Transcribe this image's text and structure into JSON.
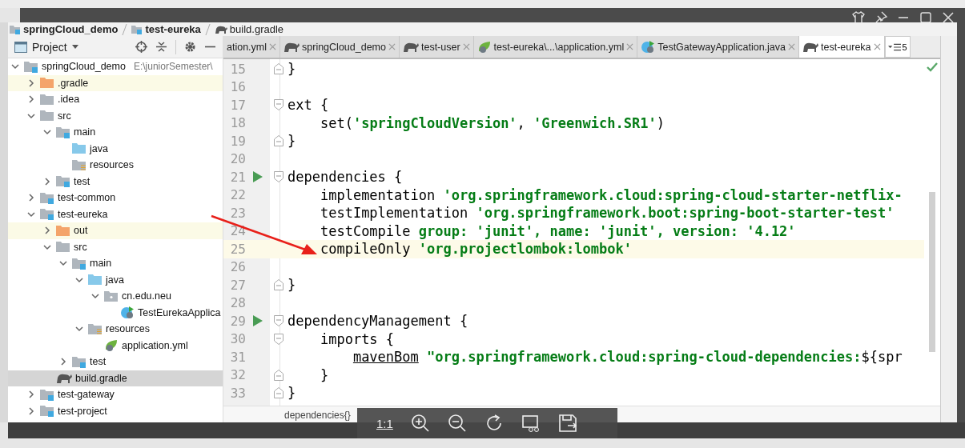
{
  "breadcrumbs": [
    {
      "label": "springCloud_demo",
      "kind": "module"
    },
    {
      "label": "test-eureka",
      "kind": "module"
    },
    {
      "label": "build.gradle",
      "kind": "gradle"
    }
  ],
  "project_panel": {
    "title": "Project"
  },
  "tree": [
    {
      "label": "springCloud_demo",
      "path": "E:\\juniorSemester\\",
      "kind": "module",
      "expanded": true,
      "selected": false,
      "children": [
        {
          "label": ".gradle",
          "kind": "excluded",
          "expanded": false,
          "selected": false
        },
        {
          "label": ".idea",
          "kind": "folder",
          "expanded": false,
          "selected": false
        },
        {
          "label": "src",
          "kind": "folder",
          "expanded": true,
          "selected": false,
          "children": [
            {
              "label": "main",
              "kind": "module",
              "expanded": true,
              "selected": false,
              "children": [
                {
                  "label": "java",
                  "kind": "source",
                  "selected": false
                },
                {
                  "label": "resources",
                  "kind": "resources",
                  "selected": false
                }
              ]
            },
            {
              "label": "test",
              "kind": "module",
              "expanded": false,
              "selected": false
            }
          ]
        },
        {
          "label": "test-common",
          "kind": "module",
          "expanded": false,
          "selected": false
        },
        {
          "label": "test-eureka",
          "kind": "module",
          "expanded": true,
          "selected": false,
          "children": [
            {
              "label": "out",
              "kind": "excluded",
              "expanded": false,
              "selected": false
            },
            {
              "label": "src",
              "kind": "folder",
              "expanded": true,
              "selected": false,
              "children": [
                {
                  "label": "main",
                  "kind": "module",
                  "expanded": true,
                  "selected": false,
                  "children": [
                    {
                      "label": "java",
                      "kind": "source",
                      "expanded": true,
                      "selected": false,
                      "children": [
                        {
                          "label": "cn.edu.neu",
                          "kind": "package",
                          "expanded": true,
                          "selected": false,
                          "children": [
                            {
                              "label": "TestEurekaApplica",
                              "kind": "class",
                              "selected": false
                            }
                          ]
                        }
                      ]
                    },
                    {
                      "label": "resources",
                      "kind": "resources",
                      "expanded": true,
                      "selected": false,
                      "children": [
                        {
                          "label": "application.yml",
                          "kind": "spring",
                          "selected": false
                        }
                      ]
                    }
                  ]
                },
                {
                  "label": "test",
                  "kind": "module",
                  "expanded": false,
                  "selected": false
                }
              ]
            },
            {
              "label": "build.gradle",
              "kind": "gradle",
              "selected": true
            }
          ]
        },
        {
          "label": "test-gateway",
          "kind": "module",
          "expanded": false,
          "selected": false
        },
        {
          "label": "test-project",
          "kind": "module",
          "expanded": false,
          "selected": false
        }
      ]
    }
  ],
  "tabs": [
    {
      "label": "ation.yml",
      "kind": "plain",
      "selected": false
    },
    {
      "label": "springCloud_demo",
      "kind": "gradle",
      "selected": false
    },
    {
      "label": "test-user",
      "kind": "gradle",
      "selected": false
    },
    {
      "label": "test-eureka\\...\\application.yml",
      "kind": "spring",
      "selected": false
    },
    {
      "label": "TestGatewayApplication.java",
      "kind": "class",
      "selected": false
    },
    {
      "label": "test-eureka",
      "kind": "gradle",
      "selected": true
    }
  ],
  "tab_overflow": {
    "count": "5"
  },
  "code_lines": [
    {
      "n": "15",
      "fold_end": true,
      "segments": [
        {
          "text": "}",
          "kind": "plain"
        }
      ]
    },
    {
      "n": "16"
    },
    {
      "n": "17",
      "fold_start": true,
      "segments": [
        {
          "text": "ext {",
          "kind": "plain"
        }
      ]
    },
    {
      "n": "18",
      "segments": [
        {
          "text": "    set(",
          "kind": "plain"
        },
        {
          "text": "'springCloudVersion'",
          "kind": "str"
        },
        {
          "text": ", ",
          "kind": "plain"
        },
        {
          "text": "'Greenwich.SR1'",
          "kind": "str"
        },
        {
          "text": ")",
          "kind": "plain"
        }
      ]
    },
    {
      "n": "19",
      "fold_end": true,
      "segments": [
        {
          "text": "}",
          "kind": "plain"
        }
      ]
    },
    {
      "n": "20"
    },
    {
      "n": "21",
      "run": true,
      "fold_start": true,
      "segments": [
        {
          "text": "dependencies {",
          "kind": "plain"
        }
      ]
    },
    {
      "n": "22",
      "segments": [
        {
          "text": "    implementation ",
          "kind": "plain"
        },
        {
          "text": "'org.springframework.cloud:spring-cloud-starter-netflix-",
          "kind": "str"
        }
      ]
    },
    {
      "n": "23",
      "segments": [
        {
          "text": "    testImplementation ",
          "kind": "plain"
        },
        {
          "text": "'org.springframework.boot:spring-boot-starter-test'",
          "kind": "str"
        }
      ]
    },
    {
      "n": "24",
      "segments": [
        {
          "text": "    testCompile ",
          "kind": "plain"
        },
        {
          "text": "group: 'junit', name: 'junit', version: '4.12'",
          "kind": "str"
        }
      ]
    },
    {
      "n": "25",
      "current": true,
      "segments": [
        {
          "text": "    compileOnly ",
          "kind": "plain"
        },
        {
          "text": "'org.projectlombok:lombok'",
          "kind": "str"
        }
      ]
    },
    {
      "n": "26"
    },
    {
      "n": "27",
      "fold_end": true,
      "segments": [
        {
          "text": "}",
          "kind": "plain"
        }
      ]
    },
    {
      "n": "28"
    },
    {
      "n": "29",
      "run": true,
      "fold_start": true,
      "segments": [
        {
          "text": "dependencyManagement {",
          "kind": "plain"
        }
      ]
    },
    {
      "n": "30",
      "fold_start": true,
      "segments": [
        {
          "text": "    imports {",
          "kind": "plain"
        }
      ]
    },
    {
      "n": "31",
      "segments": [
        {
          "text": "        mavenBom",
          "kind": "link"
        },
        {
          "text": " \"org.springframework.cloud:spring-cloud-dependencies:",
          "kind": "str"
        },
        {
          "text": "${spr",
          "kind": "plain"
        }
      ]
    },
    {
      "n": "32",
      "fold_end": true,
      "segments": [
        {
          "text": "    }",
          "kind": "plain"
        }
      ]
    },
    {
      "n": "33",
      "fold_end": true,
      "segments": [
        {
          "text": "}",
          "kind": "plain"
        }
      ]
    }
  ],
  "editor_breadcrumb": "dependencies{}",
  "viewer_toolbar": {
    "actual_size": "1:1"
  }
}
